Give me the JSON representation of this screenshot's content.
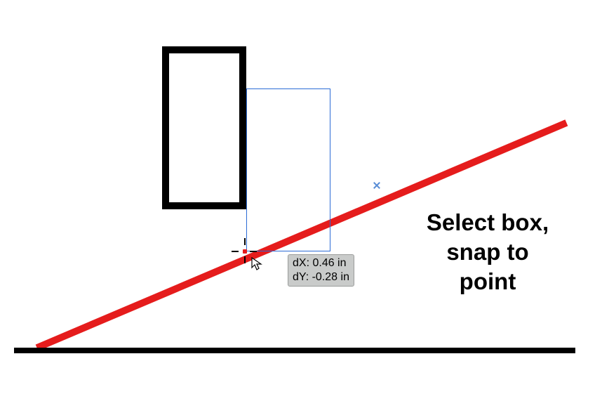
{
  "snap": {
    "dx_label": "dX:",
    "dy_label": "dY:",
    "dx_value": "0.46 in",
    "dy_value": "-0.28 in"
  },
  "caption": {
    "line1": "Select box,",
    "line2": "snap to",
    "line3": "point"
  },
  "shapes": {
    "original_box": "black-rectangle",
    "diagonal_line": "red-incline",
    "ground_line": "ground",
    "drag_preview": "blue-outline"
  }
}
